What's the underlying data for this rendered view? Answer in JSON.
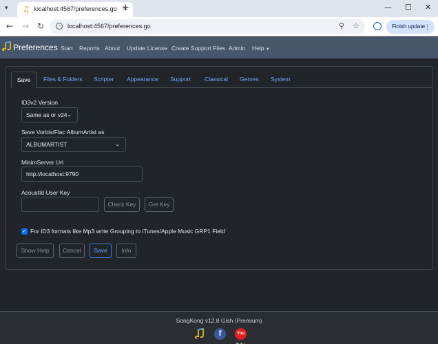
{
  "browser": {
    "tab_title": "localhost:4567/preferences.go",
    "url": "localhost:4567/preferences.go",
    "finish_update_label": "Finish update",
    "new_tab_glyph": "+",
    "close_glyph": "×",
    "icons": [
      "music-favicon",
      "back-arrow-icon",
      "forward-arrow-icon",
      "reload-icon",
      "site-info-icon",
      "zoom-icon",
      "bookmark-star-icon",
      "profile-icon",
      "menu-dots-icon",
      "minimize-icon",
      "maximize-icon",
      "close-window-icon"
    ]
  },
  "navbar": {
    "brand": "Preferences",
    "links": [
      "Start",
      "Reports",
      "About",
      "Update License",
      "Create Support Files",
      "Admin",
      "Help"
    ]
  },
  "tabs": [
    "Save",
    "Files & Folders",
    "Scripter",
    "Appearance",
    "Support",
    "Classical",
    "Genres",
    "System"
  ],
  "form": {
    "id3v2_label": "ID3v2 Version",
    "id3v2_value": "Same as or v24",
    "vorbis_label": "Save Vorbis/Flac AlbumArtist as",
    "vorbis_value": "ALBUMARTIST",
    "minim_label": "MinimServer Url",
    "minim_value": "http://localhost:9790",
    "acoustid_label": "AcoustId User Key",
    "acoustid_value": "",
    "check_key_label": "Check Key",
    "get_key_label": "Get Key",
    "grouping_checked": true,
    "grouping_label": "For ID3 formats like Mp3 write Grouping to iTunes/Apple Music GRP1 Field"
  },
  "buttons": {
    "show_help": "Show Help",
    "cancel": "Cancel",
    "save": "Save",
    "info": "Info"
  },
  "footer": {
    "text": "SongKong v12.8 Gish (Premium)",
    "facebook_glyph": "f",
    "youtube_glyph": "You Tube"
  },
  "colors": {
    "navbar": "#46566b",
    "page": "#212529",
    "link": "#6ea8fe",
    "primary": "#0d6efd"
  }
}
